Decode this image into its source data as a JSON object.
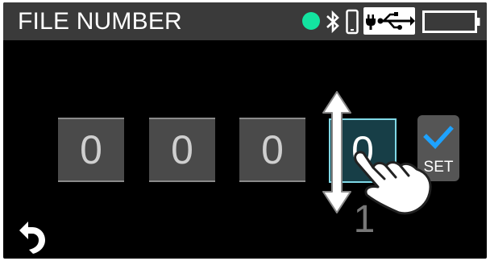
{
  "header": {
    "title": "FILE NUMBER",
    "status_dot_color": "#13e3a0",
    "icons": [
      "bluetooth-icon",
      "phone-icon",
      "usb-power-icon",
      "battery-icon"
    ]
  },
  "file_number": {
    "digits": [
      "0",
      "0",
      "0",
      "0"
    ],
    "selected_index": 3,
    "next_value": "1"
  },
  "set_button": {
    "label": "SET",
    "icon": "checkmark-icon"
  },
  "gesture_hint": {
    "icon": "swipe-hand-icon",
    "direction": "vertical"
  },
  "back_button": {
    "icon": "back-arrow-icon"
  }
}
